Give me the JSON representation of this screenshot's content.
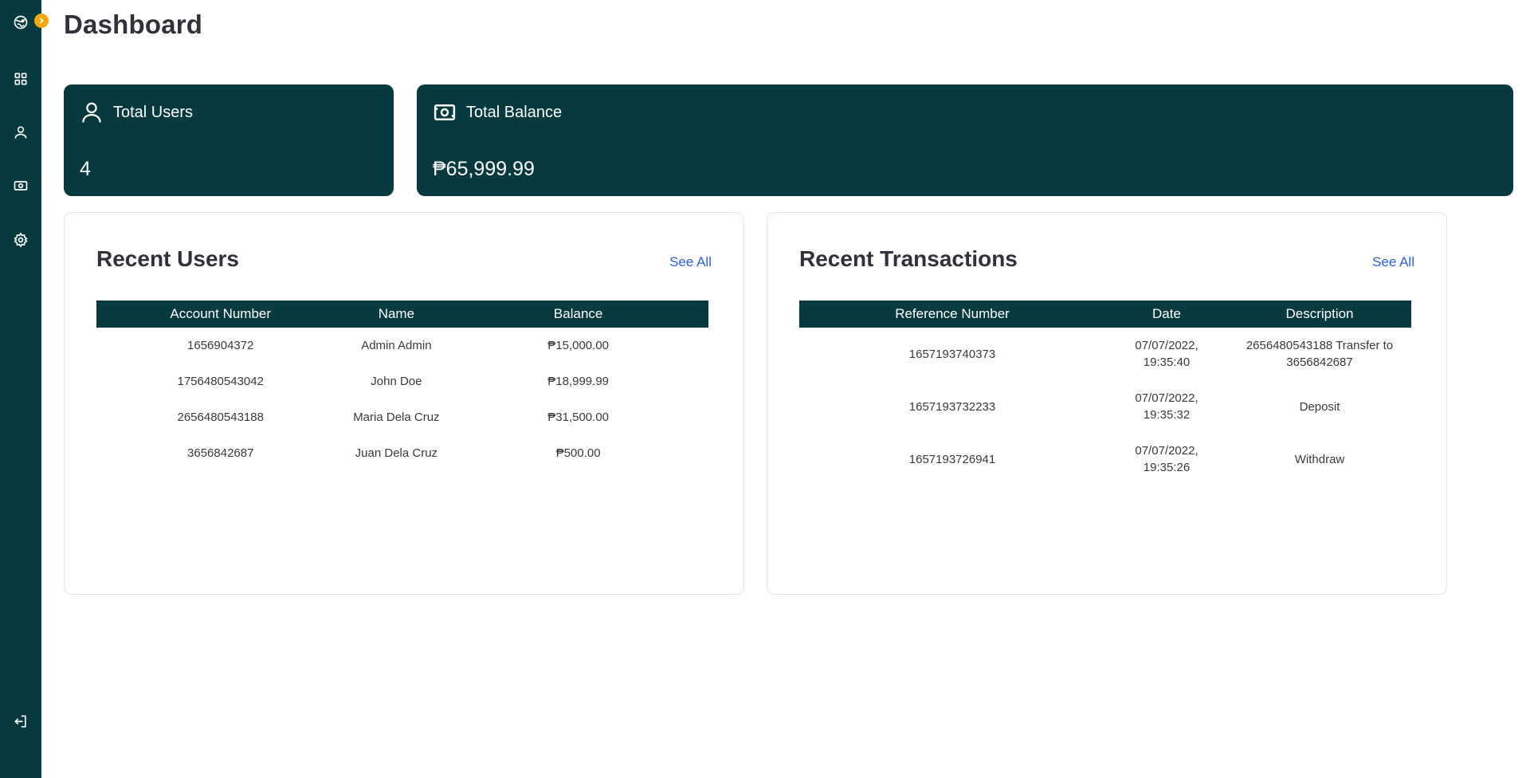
{
  "page": {
    "title": "Dashboard"
  },
  "colors": {
    "primary": "#073a3e",
    "accent": "#f4a70b",
    "link": "#2c5ee8"
  },
  "sidebar": {
    "logo_icon": "globe-coin-icon",
    "toggle_icon": "chevron-right-icon",
    "items": [
      {
        "icon": "grid-icon",
        "name": "dashboard"
      },
      {
        "icon": "user-icon",
        "name": "users"
      },
      {
        "icon": "money-icon",
        "name": "transactions"
      },
      {
        "icon": "gear-icon",
        "name": "settings"
      }
    ],
    "logout_icon": "logout-icon"
  },
  "stats": {
    "users": {
      "label": "Total Users",
      "value": "4",
      "icon": "user-icon"
    },
    "balance": {
      "label": "Total Balance",
      "value": "₱65,999.99",
      "icon": "money-icon"
    }
  },
  "recent_users": {
    "title": "Recent Users",
    "see_all": "See All",
    "columns": [
      "Account Number",
      "Name",
      "Balance"
    ],
    "rows": [
      [
        "1656904372",
        "Admin Admin",
        "₱15,000.00"
      ],
      [
        "1756480543042",
        "John Doe",
        "₱18,999.99"
      ],
      [
        "2656480543188",
        "Maria Dela Cruz",
        "₱31,500.00"
      ],
      [
        "3656842687",
        "Juan Dela Cruz",
        "₱500.00"
      ]
    ]
  },
  "recent_transactions": {
    "title": "Recent Transactions",
    "see_all": "See All",
    "columns": [
      "Reference Number",
      "Date",
      "Description"
    ],
    "rows": [
      [
        "1657193740373",
        "07/07/2022,\n19:35:40",
        "2656480543188 Transfer to\n3656842687"
      ],
      [
        "1657193732233",
        "07/07/2022,\n19:35:32",
        "Deposit"
      ],
      [
        "1657193726941",
        "07/07/2022,\n19:35:26",
        "Withdraw"
      ]
    ]
  }
}
